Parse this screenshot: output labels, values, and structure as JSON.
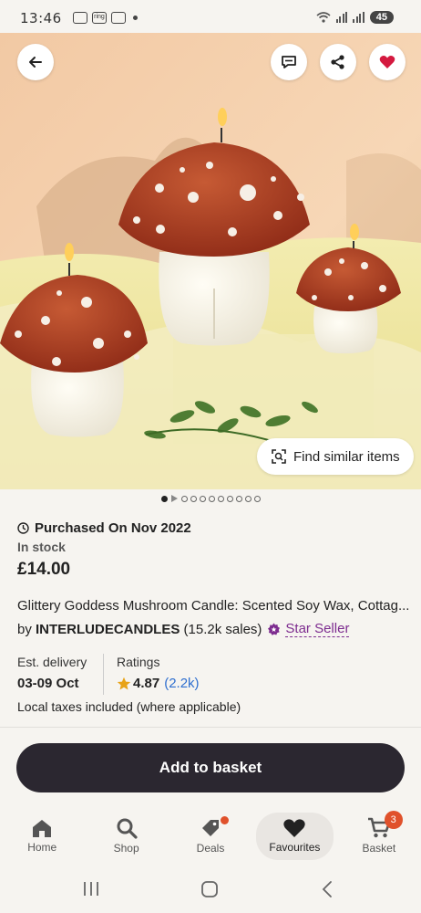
{
  "status_bar": {
    "time": "13:46",
    "ring_icon_text": "ring",
    "battery": "45"
  },
  "hero": {
    "back_icon": "arrow-left-icon",
    "message_icon": "message-icon",
    "share_icon": "share-icon",
    "favourite_icon": "heart-icon",
    "find_similar_label": "Find similar items",
    "colors": {
      "favourite": "#d4193f"
    }
  },
  "gallery": {
    "total_items": 11,
    "current_index": 0
  },
  "listing": {
    "purchased": "Purchased On Nov 2022",
    "stock": "In stock",
    "price": "£14.00",
    "title": "Glittery Goddess Mushroom Candle: Scented Soy Wax, Cottag...",
    "by_prefix": "by",
    "shop_name": "INTERLUDECANDLES",
    "sales": "(15.2k sales)",
    "star_seller": "Star Seller",
    "delivery_label": "Est. delivery",
    "delivery_value": "03-09 Oct",
    "ratings_label": "Ratings",
    "rating_value": "4.87",
    "rating_count": "(2.2k)",
    "taxes": "Local taxes included (where applicable)"
  },
  "actions": {
    "add_to_basket": "Add to basket"
  },
  "bottom_nav": {
    "items": [
      {
        "label": "Home",
        "icon": "home-icon"
      },
      {
        "label": "Shop",
        "icon": "search-icon"
      },
      {
        "label": "Deals",
        "icon": "tag-icon"
      },
      {
        "label": "Favourites",
        "icon": "heart-icon"
      },
      {
        "label": "Basket",
        "icon": "cart-icon"
      }
    ],
    "basket_count": "3",
    "active": "Favourites"
  }
}
